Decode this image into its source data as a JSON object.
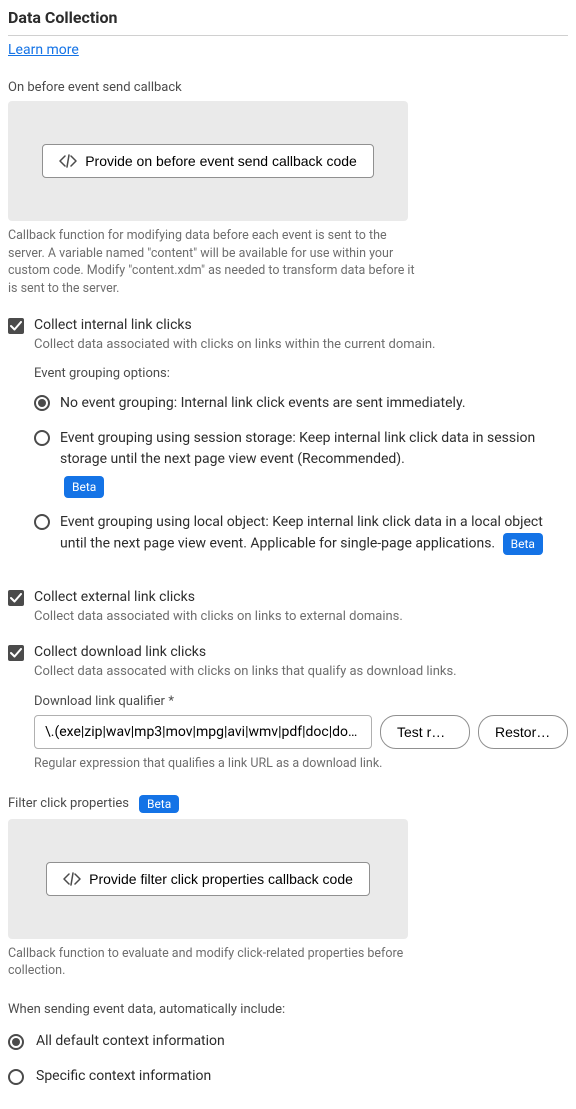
{
  "title": "Data Collection",
  "learnMore": "Learn more",
  "onBeforeSend": {
    "label": "On before event send callback",
    "button": "Provide on before event send callback code",
    "help": "Callback function for modifying data before each event is sent to the server. A variable named \"content\" will be available for use within your custom code. Modify \"content.xdm\" as needed to transform data before it is sent to the server."
  },
  "internalClicks": {
    "label": "Collect internal link clicks",
    "desc": "Collect data associated with clicks on links within the current domain.",
    "groupingLabel": "Event grouping options:",
    "options": [
      "No event grouping: Internal link click events are sent immediately.",
      "Event grouping using session storage: Keep internal link click data in session storage until the next page view event (Recommended).",
      "Event grouping using local object: Keep internal link click data in a local object until the next page view event. Applicable for single-page applications."
    ]
  },
  "externalClicks": {
    "label": "Collect external link clicks",
    "desc": "Collect data associated with clicks on links to external domains."
  },
  "downloadClicks": {
    "label": "Collect download link clicks",
    "desc": "Collect data assocated with clicks on links that qualify as download links.",
    "qualifierLabel": "Download link qualifier",
    "qualifierValue": "\\.(exe|zip|wav|mp3|mov|mpg|avi|wmv|pdf|doc|docx|xls|xlsx|ppt|pptx)$",
    "testBtn": "Test regex",
    "restoreBtn": "Restore default",
    "qualifierHelp": "Regular expression that qualifies a link URL as a download link."
  },
  "betaLabel": "Beta",
  "filterClick": {
    "label": "Filter click properties",
    "button": "Provide filter click properties callback code",
    "help": "Callback function to evaluate and modify click-related properties before collection."
  },
  "context": {
    "label": "When sending event data, automatically include:",
    "options": [
      "All default context information",
      "Specific context information"
    ]
  }
}
